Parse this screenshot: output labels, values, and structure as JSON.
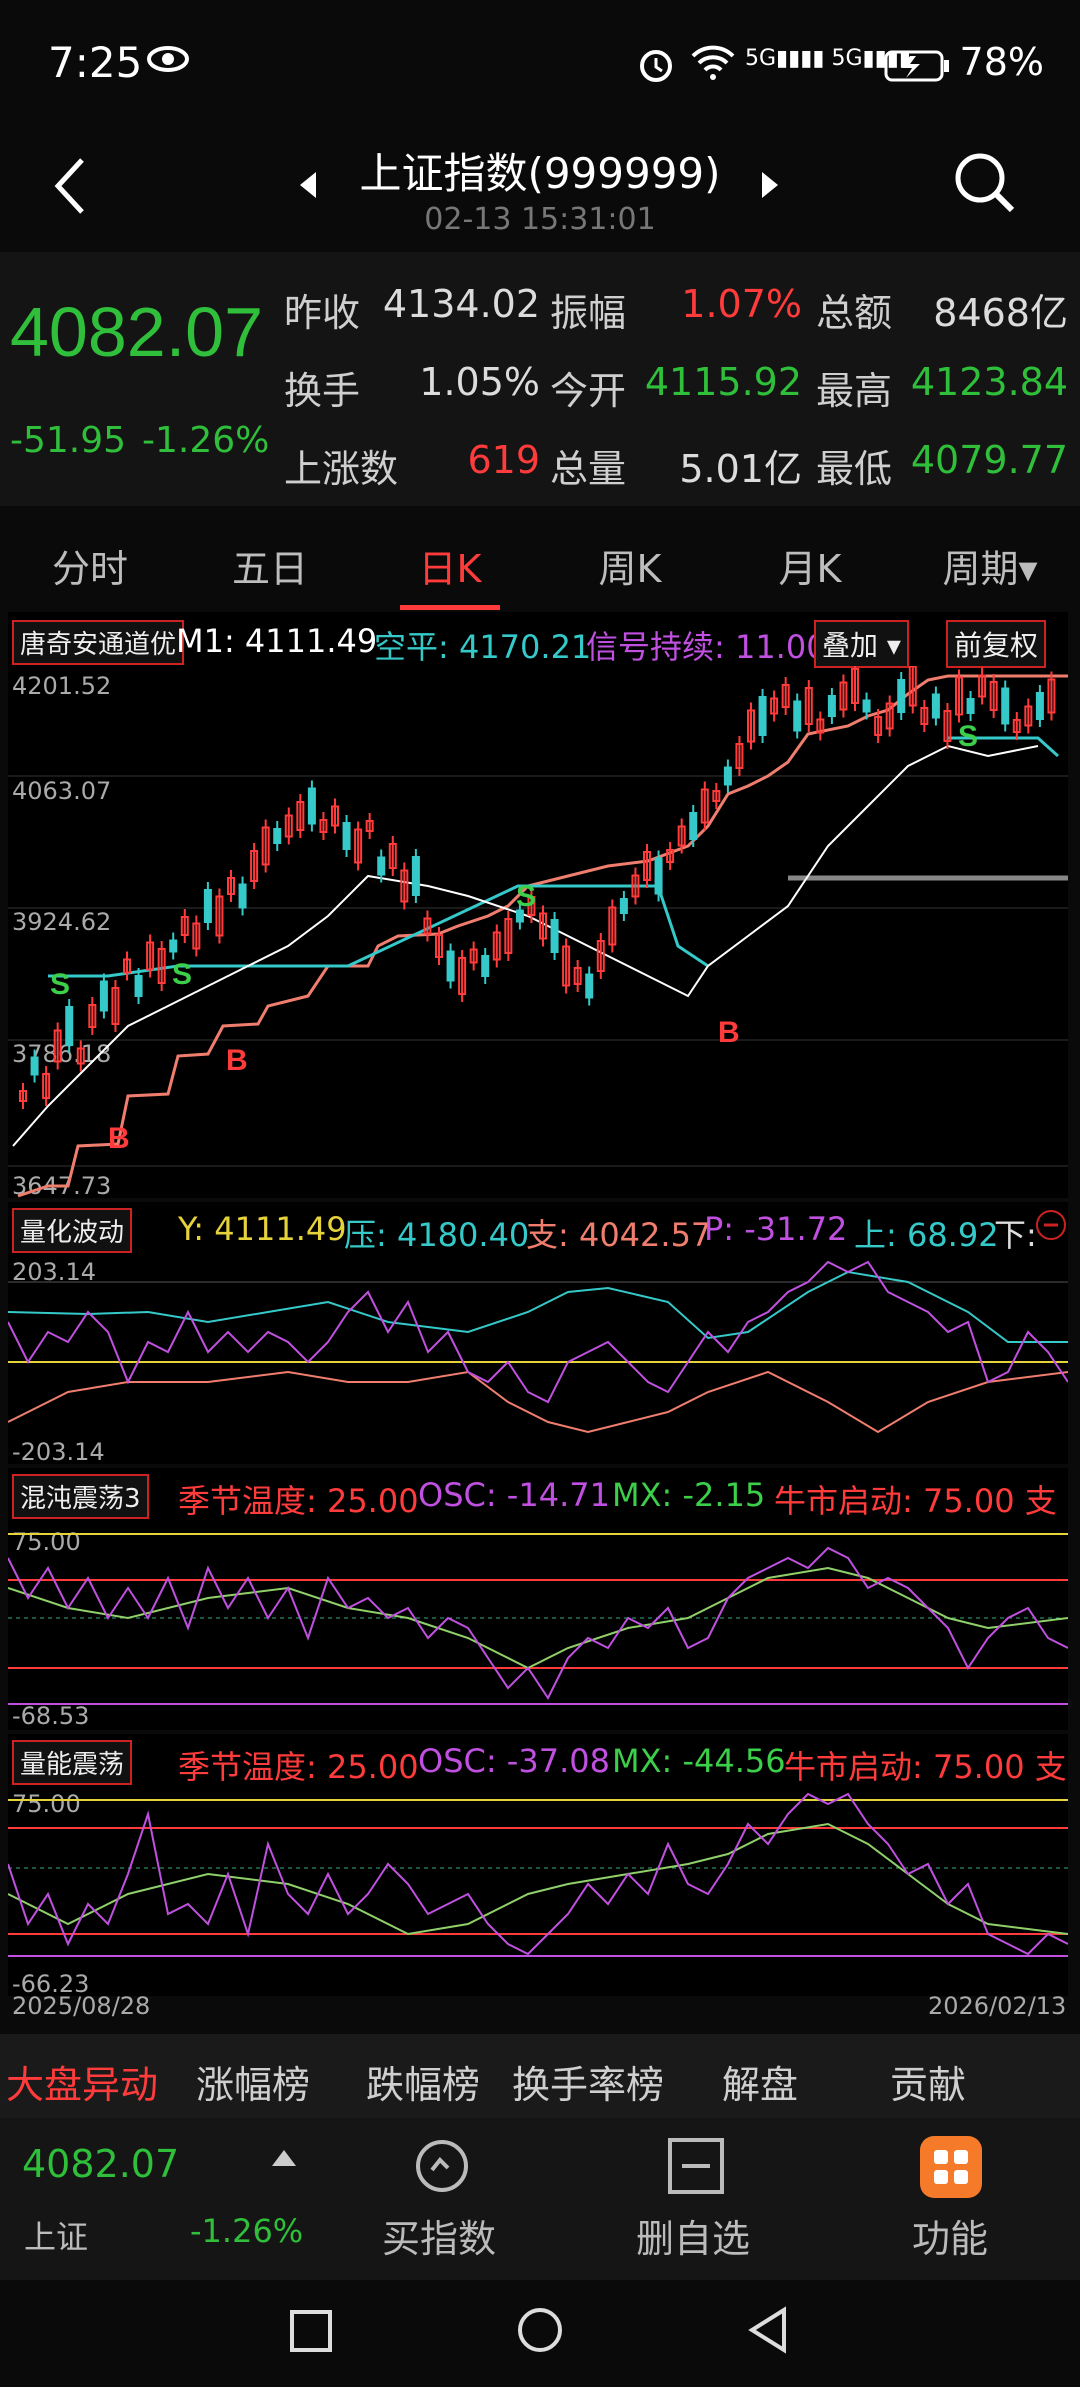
{
  "status_bar": {
    "time": "7:25",
    "battery": "78%",
    "signal": "5G 5G"
  },
  "header": {
    "title": "上证指数(999999)",
    "datetime": "02-13 15:31:01"
  },
  "quote": {
    "price": "4082.07",
    "change": "-51.95",
    "change_pct": "-1.26%",
    "prev_close_label": "昨收",
    "prev_close": "4134.02",
    "amplitude_label": "振幅",
    "amplitude": "1.07%",
    "amount_label": "总额",
    "amount": "8468亿",
    "turnover_label": "换手",
    "turnover": "1.05%",
    "open_label": "今开",
    "open": "4115.92",
    "high_label": "最高",
    "high": "4123.84",
    "rise_count_label": "上涨数",
    "rise_count": "619",
    "volume_label": "总量",
    "volume": "5.01亿",
    "low_label": "最低",
    "low": "4079.77"
  },
  "tabs": [
    "分时",
    "五日",
    "日K",
    "周K",
    "月K",
    "周期▾"
  ],
  "active_tab": "日K",
  "main_chart": {
    "indicator": "唐奇安通道优",
    "m1": "M1: 4111.49",
    "kongping": "空平: 4170.21",
    "signal": "信号持续: 11.00",
    "overlay_btn": "叠加 ▾",
    "adjust_btn": "前复权",
    "y_labels": [
      "4201.52",
      "4063.07",
      "3924.62",
      "3786.18",
      "3647.73"
    ]
  },
  "panel2": {
    "name": "量化波动",
    "y": "Y: 4111.49",
    "ya": "压: 4180.40",
    "zhi": "支: 4042.57",
    "p": "P: -31.72",
    "shang": "上: 68.92",
    "xia": "下:",
    "top": "203.14",
    "bottom": "-203.14"
  },
  "panel3": {
    "name": "混沌震荡3",
    "temp": "季节温度: 25.00",
    "osc": "OSC: -14.71",
    "mx": "MX: -2.15",
    "bull": "牛市启动: 75.00 支",
    "top": "75.00",
    "bottom": "-68.53"
  },
  "panel4": {
    "name": "量能震荡",
    "temp": "季节温度: 25.00",
    "osc": "OSC: -37.08",
    "mx": "MX: -44.56",
    "bull": "牛市启动: 75.00 支",
    "top": "75.00",
    "bottom": "-66.23",
    "date_start": "2025/08/28",
    "date_end": "2026/02/13"
  },
  "bottom_tabs": [
    "大盘异动",
    "涨幅榜",
    "跌幅榜",
    "换手率榜",
    "解盘",
    "贡献"
  ],
  "bottom_bar": {
    "price": "4082.07",
    "name": "上证",
    "pct": "-1.26%",
    "buy_label": "买指数",
    "delete_label": "删自选",
    "func_label": "功能"
  },
  "colors": {
    "up": "#ff3b3b",
    "down": "#2fbf3a",
    "cyan": "#35c9c9",
    "magenta": "#c050e0",
    "yellow": "#e6d23a"
  }
}
